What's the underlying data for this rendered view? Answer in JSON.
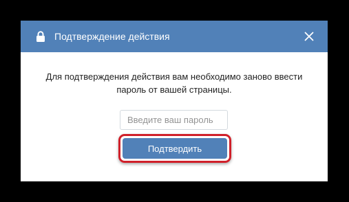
{
  "dialog": {
    "title": "Подтверждение действия",
    "lock_icon": "lock-icon",
    "close_icon": "close-icon",
    "message_line1": "Для подтверждения действия вам необходимо заново ввести",
    "message_line2": "пароль от вашей страницы.",
    "password_placeholder": "Введите ваш пароль",
    "password_value": "",
    "confirm_label": "Подтвердить"
  },
  "colors": {
    "header": "#5181b8",
    "button": "#5181b8",
    "highlight": "#d0202a",
    "backdrop": "#000000"
  }
}
